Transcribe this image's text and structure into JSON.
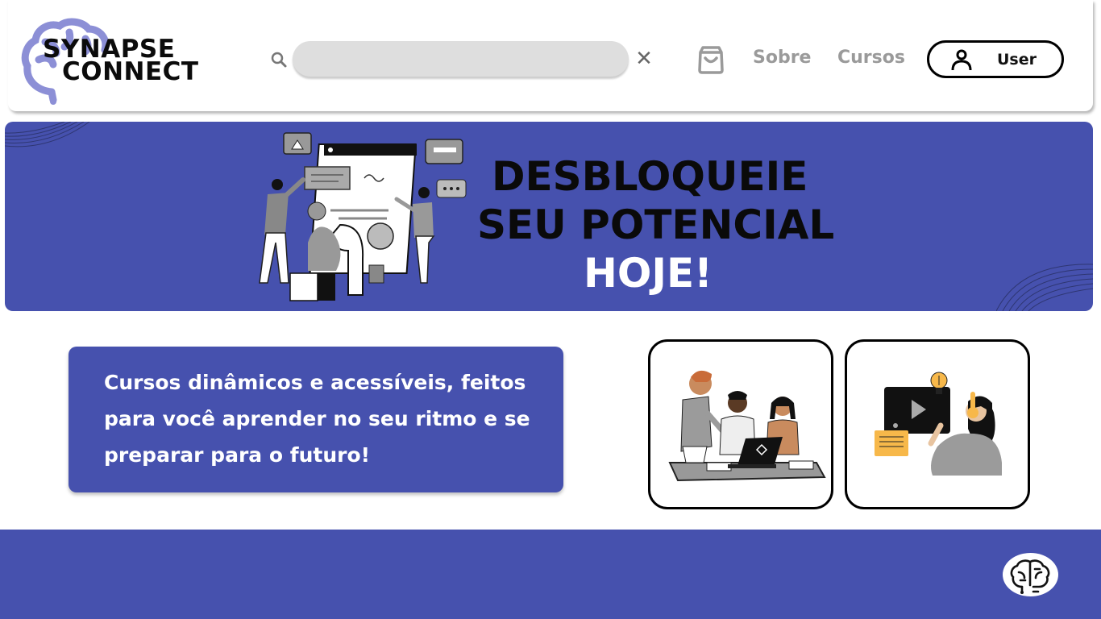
{
  "header": {
    "logo": {
      "line1": "SYNAPSE",
      "line2": "CONNECT",
      "icon": "brain-icon"
    },
    "search": {
      "value": "",
      "placeholder": ""
    },
    "nav": {
      "sobre": "Sobre",
      "cursos": "Cursos"
    },
    "user_button": {
      "label": "User",
      "icon": "user-icon"
    },
    "cart_icon": "shopping-bag-icon"
  },
  "hero": {
    "line1": "DESBLOQUEIE",
    "line2": "SEU POTENCIAL",
    "line3": "HOJE!"
  },
  "description": {
    "text": "Cursos dinâmicos e acessíveis, feitos para você aprender no seu ritmo e se preparar para o futuro!"
  },
  "cards": [
    {
      "illustration": "students-with-laptop"
    },
    {
      "illustration": "online-video-class"
    }
  ],
  "footer": {
    "logo_icon": "brain-icon"
  },
  "colors": {
    "primary": "#4651ae",
    "logo_accent": "#8c8fd6",
    "nav_text": "#9a9a9a",
    "search_bg": "#dedede"
  }
}
